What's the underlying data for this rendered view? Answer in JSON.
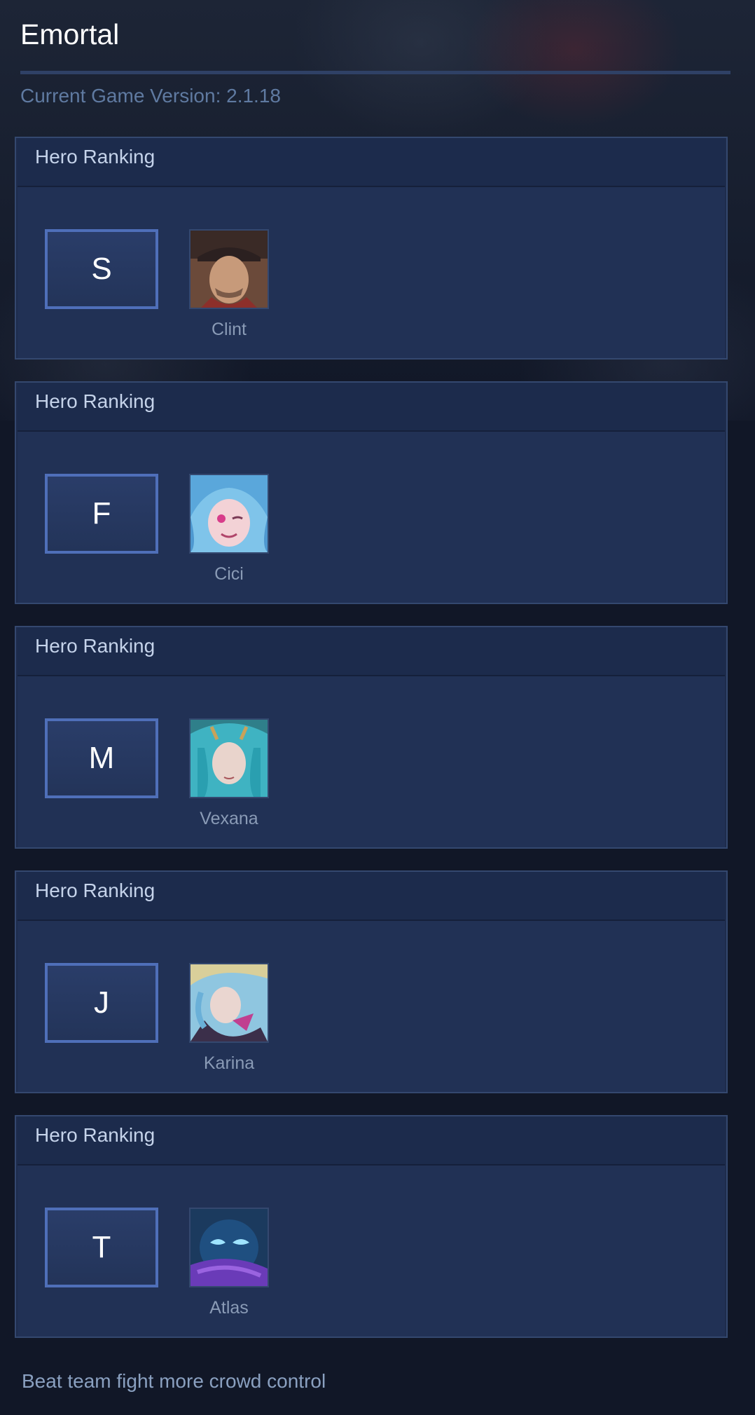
{
  "header": {
    "title": "Emortal",
    "version_text": "Current Game Version: 2.1.18"
  },
  "rankings": [
    {
      "header": "Hero Ranking",
      "tier": "S",
      "hero": "Clint",
      "icon": "clint-portrait-icon"
    },
    {
      "header": "Hero Ranking",
      "tier": "F",
      "hero": "Cici",
      "icon": "cici-portrait-icon"
    },
    {
      "header": "Hero Ranking",
      "tier": "M",
      "hero": "Vexana",
      "icon": "vexana-portrait-icon"
    },
    {
      "header": "Hero Ranking",
      "tier": "J",
      "hero": "Karina",
      "icon": "karina-portrait-icon"
    },
    {
      "header": "Hero Ranking",
      "tier": "T",
      "hero": "Atlas",
      "icon": "atlas-portrait-icon"
    }
  ],
  "footer": {
    "note": "Beat team fight more crowd control"
  },
  "colors": {
    "background": "#111727",
    "card": "#1e2c4c",
    "tier_border": "#4f6fb9",
    "accent_text": "#5f7aa1"
  }
}
